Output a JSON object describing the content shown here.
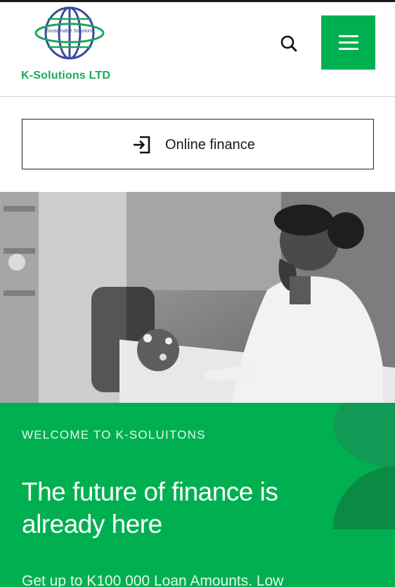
{
  "header": {
    "logo_globe_text": "Sustainable Solutions",
    "logo_name": "K-Solutions LTD",
    "brand_color": "#00b050",
    "search_icon": "search-icon",
    "menu_icon": "hamburger-menu-icon"
  },
  "online_finance": {
    "label": "Online finance",
    "icon": "login-icon"
  },
  "hero": {
    "image": "photo of a smiling woman on the phone at an office desk"
  },
  "welcome": {
    "eyebrow": "WELCOME TO K-SOLUITONS",
    "headline": "The future of finance is already here",
    "subtext": "Get up to K100 000 Loan Amounts. Low"
  }
}
